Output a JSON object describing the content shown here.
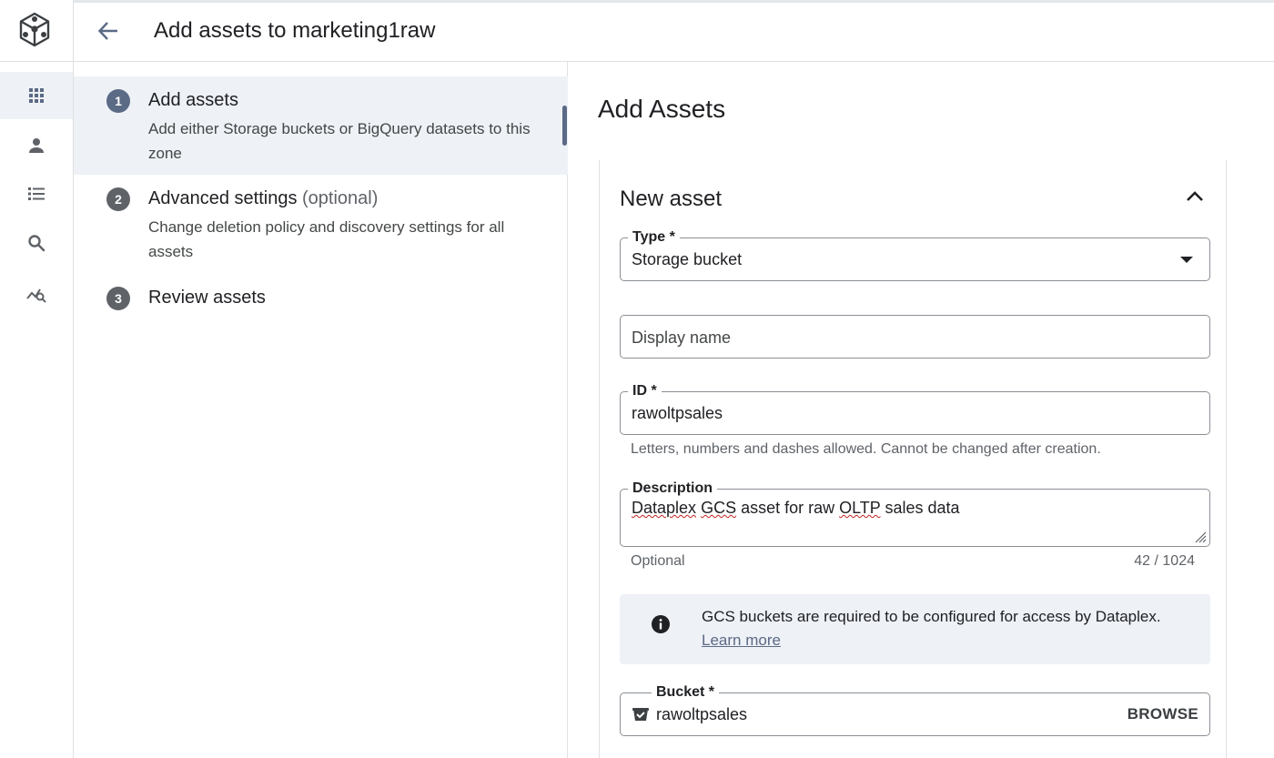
{
  "app": {
    "title": "Add assets to marketing1raw"
  },
  "rail": {
    "items": [
      {
        "icon": "grid-icon",
        "active": true
      },
      {
        "icon": "person-icon",
        "active": false
      },
      {
        "icon": "list-icon",
        "active": false
      },
      {
        "icon": "search-icon",
        "active": false
      },
      {
        "icon": "insights-icon",
        "active": false
      }
    ]
  },
  "stepper": {
    "steps": [
      {
        "number": "1",
        "label": "Add assets",
        "optional": "",
        "description": "Add either Storage buckets or BigQuery datasets to this zone",
        "active": true
      },
      {
        "number": "2",
        "label": "Advanced settings",
        "optional": "(optional)",
        "description": "Change deletion policy and discovery settings for all assets",
        "active": false
      },
      {
        "number": "3",
        "label": "Review assets",
        "optional": "",
        "description": "",
        "active": false
      }
    ]
  },
  "main": {
    "heading": "Add Assets",
    "card": {
      "title": "New asset",
      "type_field": {
        "label": "Type *",
        "value": "Storage bucket"
      },
      "display_name_field": {
        "placeholder": "Display name"
      },
      "id_field": {
        "label": "ID *",
        "value": "rawoltpsales",
        "hint": "Letters, numbers and dashes allowed. Cannot be changed after creation."
      },
      "description_field": {
        "label": "Description",
        "value_parts": [
          "Dataplex",
          " ",
          "GCS",
          " asset for raw ",
          "OLTP",
          " sales data"
        ],
        "hint": "Optional",
        "counter": "42 / 1024"
      },
      "notice": {
        "text": "GCS buckets are required to be configured for access by Dataplex.",
        "link": "Learn more"
      },
      "bucket_field": {
        "label": "Bucket *",
        "value": "rawoltpsales",
        "action": "BROWSE"
      }
    }
  },
  "colors": {
    "accent": "#5b6a85",
    "active_bg": "#eef1f6",
    "border": "#e0e0e0",
    "outline": "#8a8f94"
  }
}
